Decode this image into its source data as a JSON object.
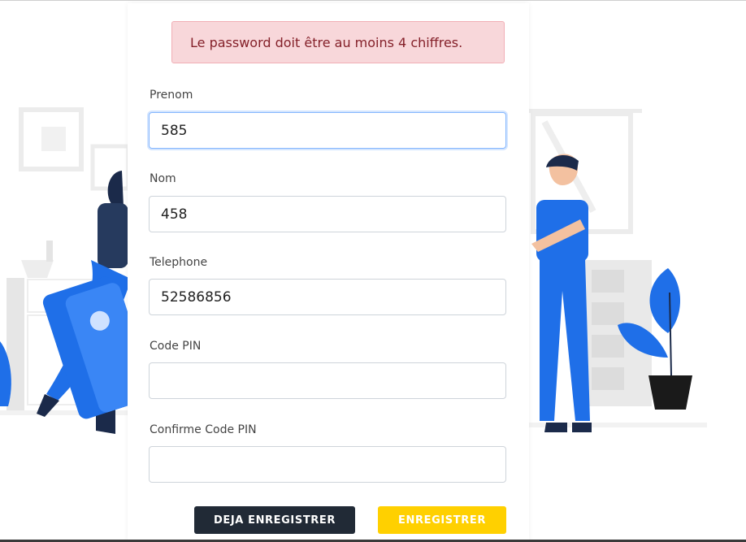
{
  "alert": {
    "message": "Le password doit être au moins 4 chiffres."
  },
  "form": {
    "fields": [
      {
        "label": "Prenom",
        "value": "585"
      },
      {
        "label": "Nom",
        "value": "458"
      },
      {
        "label": "Telephone",
        "value": "52586856"
      },
      {
        "label": "Code PIN",
        "value": ""
      },
      {
        "label": "Confirme Code PIN",
        "value": ""
      }
    ]
  },
  "buttons": {
    "already_registered": "DEJA ENREGISTRER",
    "register": "ENREGISTRER"
  },
  "colors": {
    "alert_bg": "#f8d7da",
    "alert_text": "#842029",
    "illustration_blue": "#1f6fe8",
    "dark_button": "#212a36",
    "yellow_button": "#ffd000"
  }
}
